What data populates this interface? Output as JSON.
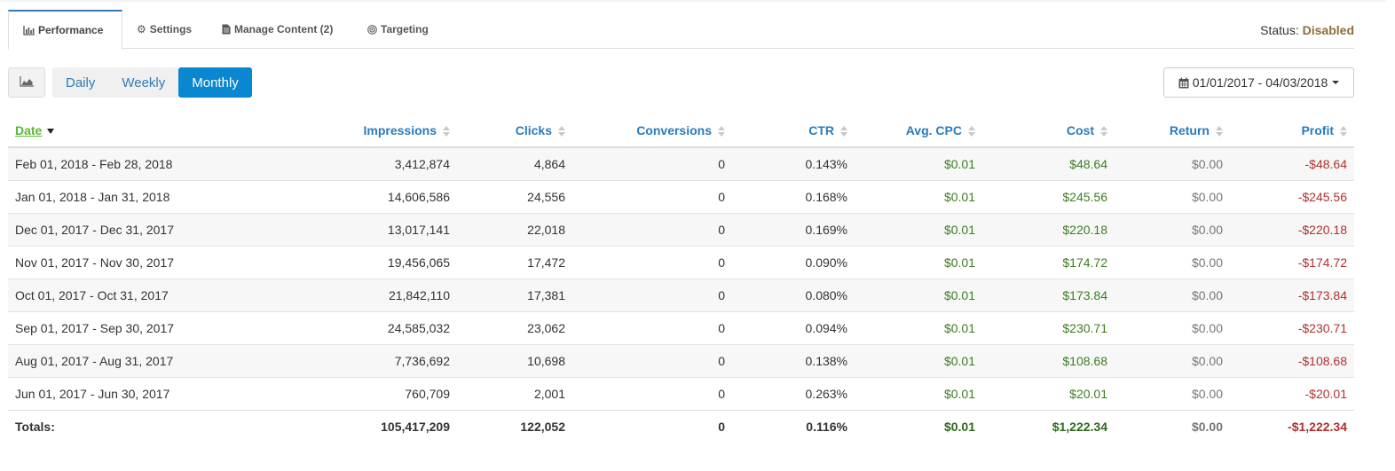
{
  "tabs": [
    {
      "label": "Performance",
      "icon": "bar-chart-icon",
      "active": true
    },
    {
      "label": "Settings",
      "icon": "gear-icon",
      "active": false
    },
    {
      "label": "Manage Content (2)",
      "icon": "document-icon",
      "active": false
    },
    {
      "label": "Targeting",
      "icon": "target-icon",
      "active": false
    }
  ],
  "status": {
    "label": "Status:",
    "value": "Disabled"
  },
  "toolbar": {
    "chart_icon": "area-chart-icon",
    "periods": [
      "Daily",
      "Weekly",
      "Monthly"
    ],
    "active_period": "Monthly"
  },
  "date_range": {
    "icon": "calendar-icon",
    "value": "01/01/2017 - 04/03/2018"
  },
  "table": {
    "columns": [
      "Date",
      "Impressions",
      "Clicks",
      "Conversions",
      "CTR",
      "Avg. CPC",
      "Cost",
      "Return",
      "Profit"
    ],
    "sorted_by": "Date",
    "sort_direction": "desc",
    "rows": [
      [
        "Feb 01, 2018 - Feb 28, 2018",
        "3,412,874",
        "4,864",
        "0",
        "0.143%",
        "$0.01",
        "$48.64",
        "$0.00",
        "-$48.64"
      ],
      [
        "Jan 01, 2018 - Jan 31, 2018",
        "14,606,586",
        "24,556",
        "0",
        "0.168%",
        "$0.01",
        "$245.56",
        "$0.00",
        "-$245.56"
      ],
      [
        "Dec 01, 2017 - Dec 31, 2017",
        "13,017,141",
        "22,018",
        "0",
        "0.169%",
        "$0.01",
        "$220.18",
        "$0.00",
        "-$220.18"
      ],
      [
        "Nov 01, 2017 - Nov 30, 2017",
        "19,456,065",
        "17,472",
        "0",
        "0.090%",
        "$0.01",
        "$174.72",
        "$0.00",
        "-$174.72"
      ],
      [
        "Oct 01, 2017 - Oct 31, 2017",
        "21,842,110",
        "17,381",
        "0",
        "0.080%",
        "$0.01",
        "$173.84",
        "$0.00",
        "-$173.84"
      ],
      [
        "Sep 01, 2017 - Sep 30, 2017",
        "24,585,032",
        "23,062",
        "0",
        "0.094%",
        "$0.01",
        "$230.71",
        "$0.00",
        "-$230.71"
      ],
      [
        "Aug 01, 2017 - Aug 31, 2017",
        "7,736,692",
        "10,698",
        "0",
        "0.138%",
        "$0.01",
        "$108.68",
        "$0.00",
        "-$108.68"
      ],
      [
        "Jun 01, 2017 - Jun 30, 2017",
        "760,709",
        "2,001",
        "0",
        "0.263%",
        "$0.01",
        "$20.01",
        "$0.00",
        "-$20.01"
      ]
    ],
    "totals": [
      "Totals:",
      "105,417,209",
      "122,052",
      "0",
      "0.116%",
      "$0.01",
      "$1,222.34",
      "$0.00",
      "-$1,222.34"
    ]
  },
  "colors": {
    "accent": "#0a87d1",
    "header_text": "#2a7bbd",
    "sorted_header": "#5cb832",
    "status_disabled": "#8a6d3b",
    "money_positive": "#3c7d22",
    "money_negative": "#b0302e",
    "neutral": "#777777"
  }
}
